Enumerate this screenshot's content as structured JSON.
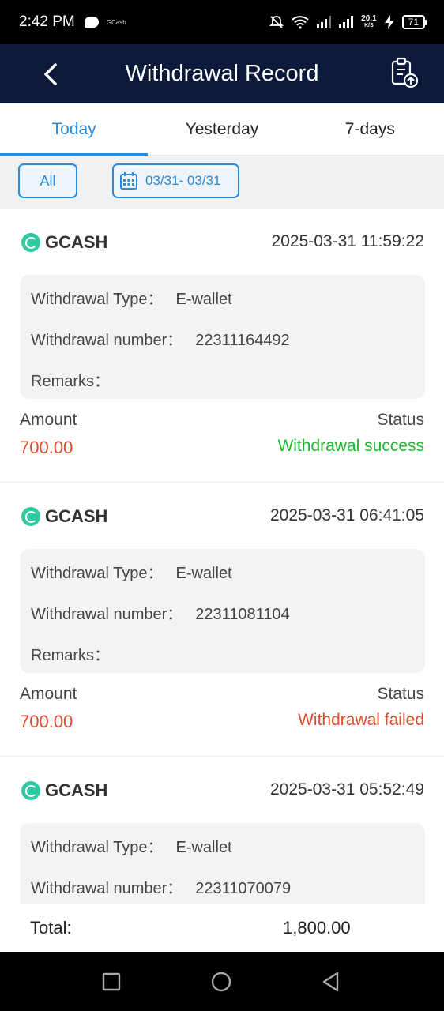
{
  "status_bar": {
    "time": "2:42 PM",
    "app_mini": "GCash",
    "net_speed": "20.1",
    "net_unit": "K/S",
    "battery": "71"
  },
  "header": {
    "title": "Withdrawal Record"
  },
  "tabs": [
    {
      "label": "Today",
      "active": true
    },
    {
      "label": "Yesterday",
      "active": false
    },
    {
      "label": "7-days",
      "active": false
    }
  ],
  "filters": {
    "all_label": "All",
    "date_range": "03/31- 03/31"
  },
  "labels": {
    "type": "Withdrawal Type：",
    "number": "Withdrawal number：",
    "remarks": "Remarks：",
    "amount": "Amount",
    "status": "Status"
  },
  "records": [
    {
      "brand": "GCASH",
      "datetime": "2025-03-31 11:59:22",
      "type": "E-wallet",
      "number": "22311164492",
      "remarks": "",
      "amount": "700.00",
      "status": "Withdrawal success",
      "status_color": "#22b530"
    },
    {
      "brand": "GCASH",
      "datetime": "2025-03-31 06:41:05",
      "type": "E-wallet",
      "number": "22311081104",
      "remarks": "",
      "amount": "700.00",
      "status": "Withdrawal failed",
      "status_color": "#e24a2b"
    },
    {
      "brand": "GCASH",
      "datetime": "2025-03-31 05:52:49",
      "type": "E-wallet",
      "number": "22311070079",
      "remarks": "",
      "amount": "",
      "status": "",
      "status_color": "#22b530"
    }
  ],
  "total": {
    "label": "Total:",
    "value": "1,800.00"
  },
  "colors": {
    "header_bg": "#0b1a3a",
    "accent": "#2b8bd8",
    "amount": "#e24a2b",
    "gcash_green": "#2fcaa0"
  }
}
